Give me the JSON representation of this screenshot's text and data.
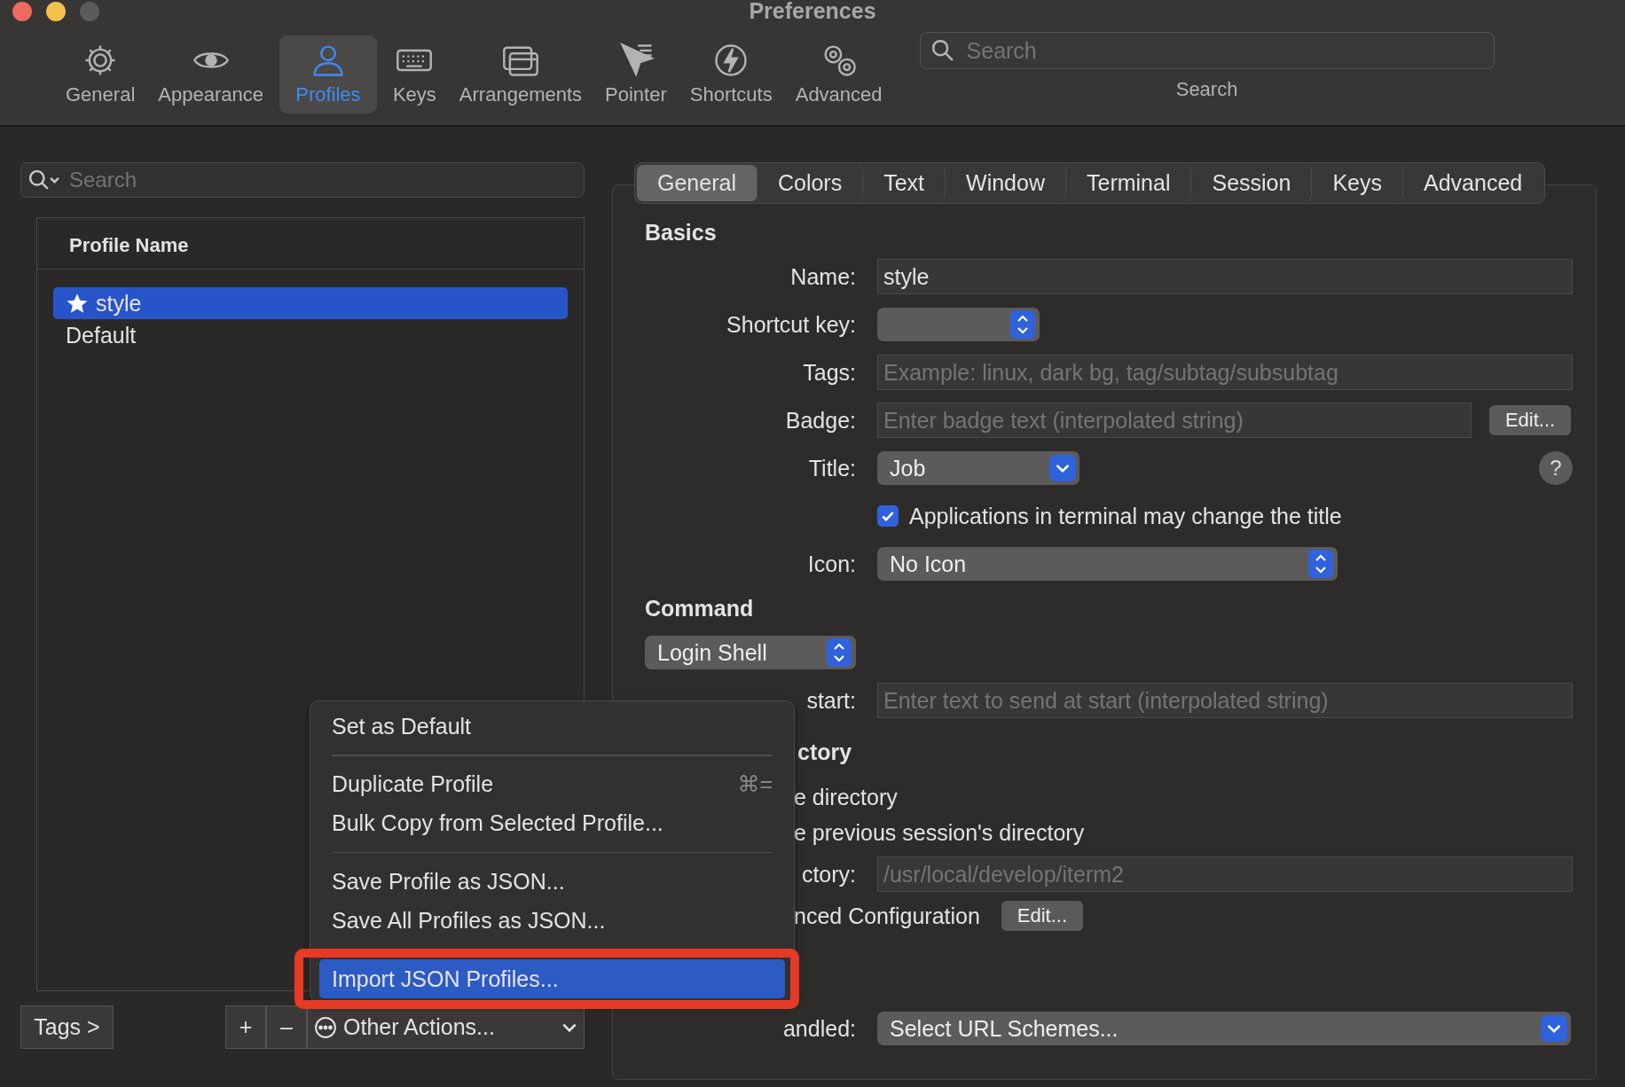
{
  "window": {
    "title": "Preferences"
  },
  "toolbar": [
    {
      "label": "General",
      "selected": false
    },
    {
      "label": "Appearance",
      "selected": false
    },
    {
      "label": "Profiles",
      "selected": true
    },
    {
      "label": "Keys",
      "selected": false
    },
    {
      "label": "Arrangements",
      "selected": false
    },
    {
      "label": "Pointer",
      "selected": false
    },
    {
      "label": "Shortcuts",
      "selected": false
    },
    {
      "label": "Advanced",
      "selected": false
    }
  ],
  "toolbar_search": {
    "placeholder": "Search",
    "caption": "Search"
  },
  "profiles": {
    "search_placeholder": "Search",
    "column": "Profile Name",
    "items": [
      {
        "name": "style",
        "default": true,
        "selected": true
      },
      {
        "name": "Default",
        "default": false,
        "selected": false
      }
    ],
    "tags_button": "Tags >",
    "add": "+",
    "remove": "–",
    "other_actions": "Other Actions..."
  },
  "tabs": [
    {
      "label": "General",
      "selected": true
    },
    {
      "label": "Colors",
      "selected": false
    },
    {
      "label": "Text",
      "selected": false
    },
    {
      "label": "Window",
      "selected": false
    },
    {
      "label": "Terminal",
      "selected": false
    },
    {
      "label": "Session",
      "selected": false
    },
    {
      "label": "Keys",
      "selected": false
    },
    {
      "label": "Advanced",
      "selected": false
    }
  ],
  "rows": [
    {
      "kind": "heading",
      "text": "Basics"
    },
    {
      "kind": "text",
      "label": "Name:",
      "value": "style"
    },
    {
      "kind": "popup",
      "label": "Shortcut key:"
    },
    {
      "kind": "text",
      "label": "Tags:",
      "placeholder": "Example: linux, dark bg, tag/subtag/subsubtag"
    },
    {
      "kind": "text",
      "label": "Badge:",
      "placeholder": "Enter badge text (interpolated string)",
      "button": "Edit..."
    },
    {
      "kind": "pulldown",
      "label": "Title:",
      "value": "Job",
      "help": "?"
    },
    {
      "kind": "checkbox",
      "text": "Applications in terminal may change the title",
      "checked": true
    },
    {
      "kind": "popup",
      "label": "Icon:",
      "value": "No Icon"
    },
    {
      "kind": "heading",
      "text": "Command"
    },
    {
      "kind": "popup",
      "value": "Login Shell"
    },
    {
      "kind": "text",
      "label": "start:",
      "placeholder": "Enter text to send at start (interpolated string)"
    },
    {
      "kind": "tail_heading",
      "text": "ctory"
    },
    {
      "kind": "tail_text",
      "text": "e directory"
    },
    {
      "kind": "tail_text",
      "text": "e previous session's directory"
    },
    {
      "kind": "text",
      "label": "ctory:",
      "placeholder": "/usr/local/develop/iterm2"
    },
    {
      "kind": "tail_text",
      "text": "nced Configuration",
      "button": "Edit..."
    },
    {
      "kind": "pulldown",
      "label": "andled:",
      "value": "Select URL Schemes..."
    }
  ],
  "menu": [
    {
      "kind": "item",
      "label": "Set as Default",
      "selected": false
    },
    {
      "kind": "separator"
    },
    {
      "kind": "item",
      "label": "Duplicate Profile",
      "shortcut": "⌘=",
      "selected": false
    },
    {
      "kind": "item",
      "label": "Bulk Copy from Selected Profile...",
      "selected": false
    },
    {
      "kind": "separator"
    },
    {
      "kind": "item",
      "label": "Save Profile as JSON...",
      "selected": false
    },
    {
      "kind": "item",
      "label": "Save All Profiles as JSON...",
      "selected": false
    },
    {
      "kind": "item",
      "label": "Import JSON Profiles...",
      "selected": true
    }
  ]
}
